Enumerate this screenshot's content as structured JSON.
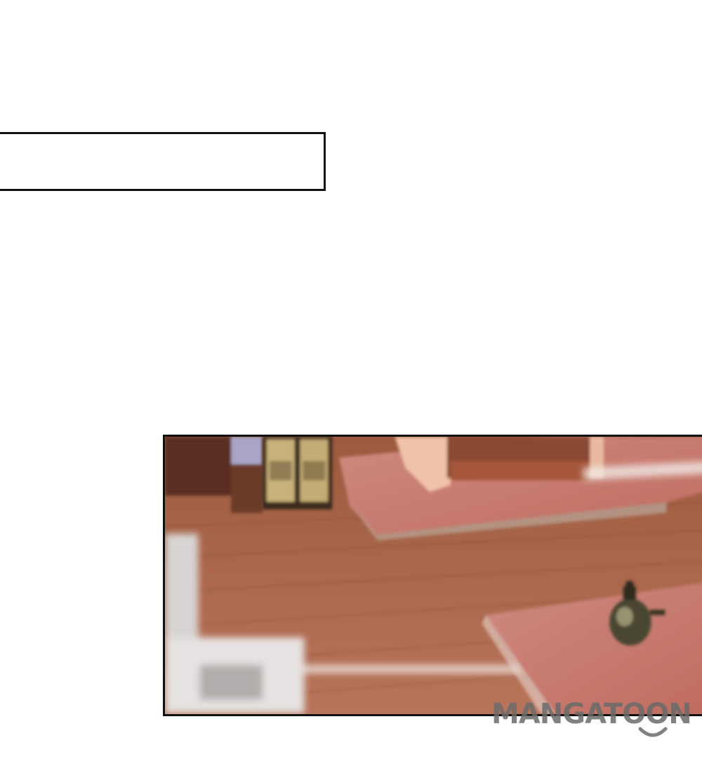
{
  "page": {
    "background": "#ffffff"
  },
  "caption_box": {
    "text": "",
    "border_color": "#111111"
  },
  "scene_panel": {
    "description_icon": "interior-room-floor-image",
    "border_color": "#111111",
    "floor_color": "#b06a4c",
    "rug_color": "#c8786c"
  },
  "watermark": {
    "text": "MANGATOON",
    "color": "#6b6b6b",
    "icon": "smile-curve-icon"
  }
}
